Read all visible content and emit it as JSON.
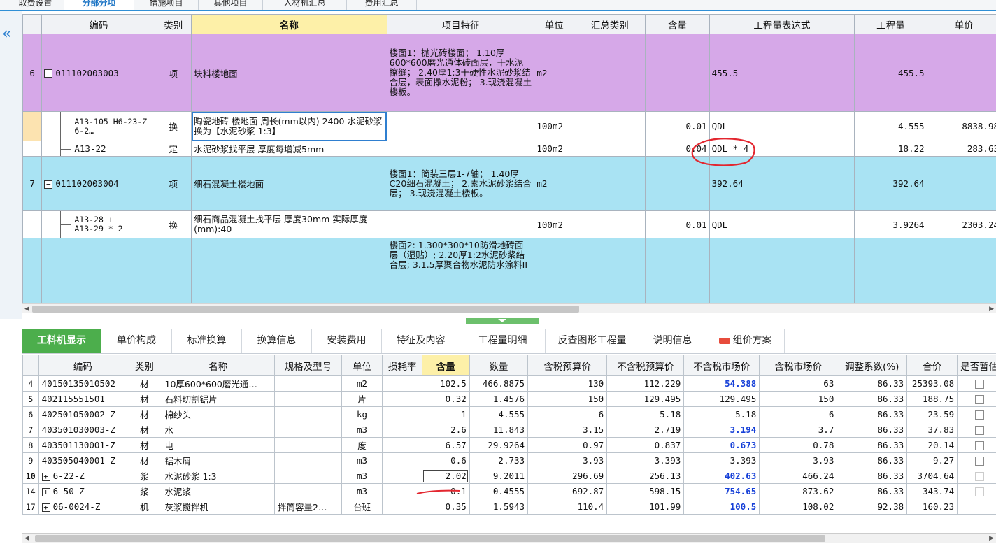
{
  "top_tabs": [
    "取费设置",
    "分部分项",
    "措施项目",
    "其他项目",
    "人材机汇总",
    "费用汇总"
  ],
  "collapse_icon": "«",
  "upper_table": {
    "headers": [
      "编码",
      "类别",
      "名称",
      "项目特征",
      "单位",
      "汇总类别",
      "含量",
      "工程量表达式",
      "工程量",
      "单价"
    ],
    "rows": [
      {
        "no": "6",
        "code": "011102003003",
        "type": "项",
        "name": "块料楼地面",
        "feature": "楼面1：抛光砖楼面；\n1.10厚600*600磨光通体砖面层，干水泥擦缝；\n2.40厚1:3干硬性水泥砂浆结合层，表面撒水泥粉；\n3.现浇混凝土楼板。",
        "unit": "m2",
        "summary": "",
        "content": "",
        "expr": "455.5",
        "qty": "455.5",
        "price": ""
      },
      {
        "no": "",
        "code": "A13-105\nH6-23-Z 6-2…",
        "type": "换",
        "name": "陶瓷地砖 楼地面 周长(mm以内) 2400 水泥砂浆  换为【水泥砂浆 1:3】",
        "feature": "",
        "unit": "100m2",
        "summary": "",
        "content": "0.01",
        "expr": "QDL",
        "qty": "4.555",
        "price": "8838.98"
      },
      {
        "no": "",
        "code": "A13-22",
        "type": "定",
        "name": "水泥砂浆找平层 厚度每增减5mm",
        "feature": "",
        "unit": "100m2",
        "summary": "",
        "content": "0.04",
        "expr": "QDL * 4",
        "qty": "18.22",
        "price": "283.63"
      },
      {
        "no": "7",
        "code": "011102003004",
        "type": "项",
        "name": "细石混凝土楼地面",
        "feature": "楼面1：简装三层1-7轴；\n1.40厚C20细石混凝土；\n2.素水泥砂浆结合层；\n3.现浇混凝土楼板。",
        "unit": "m2",
        "summary": "",
        "content": "",
        "expr": "392.64",
        "qty": "392.64",
        "price": ""
      },
      {
        "no": "",
        "code": "A13-28 +\nA13-29 * 2",
        "type": "换",
        "name": "细石商品混凝土找平层 厚度30mm  实际厚度(mm):40",
        "feature": "",
        "unit": "100m2",
        "summary": "",
        "content": "0.01",
        "expr": "QDL",
        "qty": "3.9264",
        "price": "2303.24"
      },
      {
        "no": "",
        "code": "",
        "type": "",
        "name": "",
        "feature": "楼面2:\n1.300*300*10防滑地砖面层（湿贴）;\n2.20厚1:2水泥砂浆结合层;\n3.1.5厚聚合物水泥防水涂料II",
        "unit": "",
        "summary": "",
        "content": "",
        "expr": "",
        "qty": "",
        "price": ""
      }
    ]
  },
  "bottom_tabs": [
    "工料机显示",
    "单价构成",
    "标准换算",
    "换算信息",
    "安装费用",
    "特征及内容",
    "工程量明细",
    "反查图形工程量",
    "说明信息",
    "组价方案"
  ],
  "lower_table": {
    "headers": [
      "",
      "编码",
      "类别",
      "名称",
      "规格及型号",
      "单位",
      "损耗率",
      "含量",
      "数量",
      "含税预算价",
      "不含税预算价",
      "不含税市场价",
      "含税市场价",
      "调整系数(%)",
      "合价",
      "是否暂估"
    ],
    "rows": [
      {
        "idx": "4",
        "code": "40150135010502",
        "type": "材",
        "name": "10厚600*600磨光通…",
        "spec": "",
        "unit": "m2",
        "loss": "",
        "content": "102.5",
        "qty": "466.8875",
        "tax_budget": "130",
        "notax_budget": "112.229",
        "notax_market": "54.388",
        "tax_market": "63",
        "coef": "86.33",
        "total": "25393.08"
      },
      {
        "idx": "5",
        "code": "402115551501",
        "type": "材",
        "name": "石料切割锯片",
        "spec": "",
        "unit": "片",
        "loss": "",
        "content": "0.32",
        "qty": "1.4576",
        "tax_budget": "150",
        "notax_budget": "129.495",
        "notax_market": "129.495",
        "tax_market": "150",
        "coef": "86.33",
        "total": "188.75"
      },
      {
        "idx": "6",
        "code": "402501050002-Z",
        "type": "材",
        "name": "棉纱头",
        "spec": "",
        "unit": "kg",
        "loss": "",
        "content": "1",
        "qty": "4.555",
        "tax_budget": "6",
        "notax_budget": "5.18",
        "notax_market": "5.18",
        "tax_market": "6",
        "coef": "86.33",
        "total": "23.59"
      },
      {
        "idx": "7",
        "code": "403501030003-Z",
        "type": "材",
        "name": "水",
        "spec": "",
        "unit": "m3",
        "loss": "",
        "content": "2.6",
        "qty": "11.843",
        "tax_budget": "3.15",
        "notax_budget": "2.719",
        "notax_market": "3.194",
        "tax_market": "3.7",
        "coef": "86.33",
        "total": "37.83"
      },
      {
        "idx": "8",
        "code": "403501130001-Z",
        "type": "材",
        "name": "电",
        "spec": "",
        "unit": "度",
        "loss": "",
        "content": "6.57",
        "qty": "29.9264",
        "tax_budget": "0.97",
        "notax_budget": "0.837",
        "notax_market": "0.673",
        "tax_market": "0.78",
        "coef": "86.33",
        "total": "20.14"
      },
      {
        "idx": "9",
        "code": "403505040001-Z",
        "type": "材",
        "name": "锯木屑",
        "spec": "",
        "unit": "m3",
        "loss": "",
        "content": "0.6",
        "qty": "2.733",
        "tax_budget": "3.93",
        "notax_budget": "3.393",
        "notax_market": "3.393",
        "tax_market": "3.93",
        "coef": "86.33",
        "total": "9.27"
      },
      {
        "idx": "10",
        "code": "6-22-Z",
        "type": "浆",
        "name": "水泥砂浆 1:3",
        "spec": "",
        "unit": "m3",
        "loss": "",
        "content": "2.02",
        "qty": "9.2011",
        "tax_budget": "296.69",
        "notax_budget": "256.13",
        "notax_market": "402.63",
        "tax_market": "466.24",
        "coef": "86.33",
        "total": "3704.64"
      },
      {
        "idx": "14",
        "code": "6-50-Z",
        "type": "浆",
        "name": "水泥浆",
        "spec": "",
        "unit": "m3",
        "loss": "",
        "content": "0.1",
        "qty": "0.4555",
        "tax_budget": "692.87",
        "notax_budget": "598.15",
        "notax_market": "754.65",
        "tax_market": "873.62",
        "coef": "86.33",
        "total": "343.74"
      },
      {
        "idx": "17",
        "code": "06-0024-Z",
        "type": "机",
        "name": "灰浆搅拌机",
        "spec": "拌筒容量2…",
        "unit": "台班",
        "loss": "",
        "content": "0.35",
        "qty": "1.5943",
        "tax_budget": "110.4",
        "notax_budget": "101.99",
        "notax_market": "100.5",
        "tax_market": "108.02",
        "coef": "92.38",
        "total": "160.23"
      }
    ]
  }
}
